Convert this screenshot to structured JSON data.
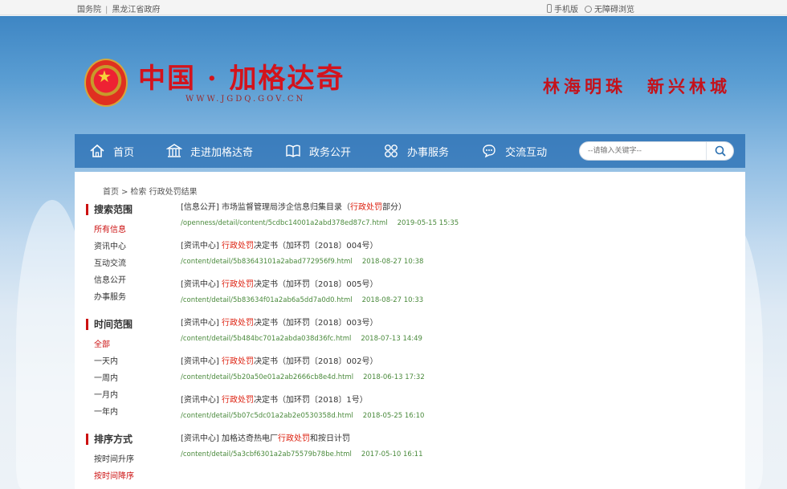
{
  "topbar": {
    "left1": "国务院",
    "sep": "|",
    "left2": "黑龙江省政府",
    "mobile": "手机版",
    "accessible": "无障碍浏览"
  },
  "header": {
    "title": "中国 · 加格达奇",
    "url": "WWW.JGDQ.GOV.CN",
    "slogan": "林海明珠　新兴林城"
  },
  "nav": {
    "items": [
      {
        "label": "首页",
        "icon": "home-icon"
      },
      {
        "label": "走进加格达奇",
        "icon": "building-icon"
      },
      {
        "label": "政务公开",
        "icon": "book-icon"
      },
      {
        "label": "办事服务",
        "icon": "grid-icon"
      },
      {
        "label": "交流互动",
        "icon": "chat-icon"
      }
    ],
    "search_placeholder": "--请输入关键字--"
  },
  "breadcrumb": {
    "home": "首页",
    "sep": ">",
    "current": "检索 行政处罚结果"
  },
  "sidebar": {
    "groups": [
      {
        "title": "搜索范围",
        "items": [
          "所有信息",
          "资讯中心",
          "互动交流",
          "信息公开",
          "办事服务"
        ],
        "active": 0
      },
      {
        "title": "时间范围",
        "items": [
          "全部",
          "一天内",
          "一周内",
          "一月内",
          "一年内"
        ],
        "active": 0
      },
      {
        "title": "排序方式",
        "items": [
          "按时间升序",
          "按时间降序"
        ],
        "active": 1
      }
    ]
  },
  "results": [
    {
      "prefix": "[信息公开] 市场监督管理局涉企信息归集目录（",
      "hl": "行政处罚",
      "suffix": "部分）",
      "url": "/openness/detail/content/5cdbc14001a2abd378ed87c7.html",
      "date": "2019-05-15 15:35"
    },
    {
      "prefix": "[资讯中心] ",
      "hl": "行政处罚",
      "suffix": "决定书（加环罚〔2018〕004号）",
      "url": "/content/detail/5b83643101a2abad772956f9.html",
      "date": "2018-08-27 10:38"
    },
    {
      "prefix": "[资讯中心] ",
      "hl": "行政处罚",
      "suffix": "决定书（加环罚〔2018〕005号）",
      "url": "/content/detail/5b83634f01a2ab6a5dd7a0d0.html",
      "date": "2018-08-27 10:33"
    },
    {
      "prefix": "[资讯中心] ",
      "hl": "行政处罚",
      "suffix": "决定书（加环罚〔2018〕003号）",
      "url": "/content/detail/5b484bc701a2abda038d36fc.html",
      "date": "2018-07-13 14:49"
    },
    {
      "prefix": "[资讯中心] ",
      "hl": "行政处罚",
      "suffix": "决定书（加环罚〔2018〕002号）",
      "url": "/content/detail/5b20a50e01a2ab2666cb8e4d.html",
      "date": "2018-06-13 17:32"
    },
    {
      "prefix": "[资讯中心] ",
      "hl": "行政处罚",
      "suffix": "决定书（加环罚〔2018〕1号）",
      "url": "/content/detail/5b07c5dc01a2ab2e0530358d.html",
      "date": "2018-05-25 16:10"
    },
    {
      "prefix": "[资讯中心] 加格达奇热电厂",
      "hl": "行政处罚",
      "suffix": "和按日计罚",
      "url": "/content/detail/5a3cbf6301a2ab75579b78be.html",
      "date": "2017-05-10 16:11"
    }
  ]
}
